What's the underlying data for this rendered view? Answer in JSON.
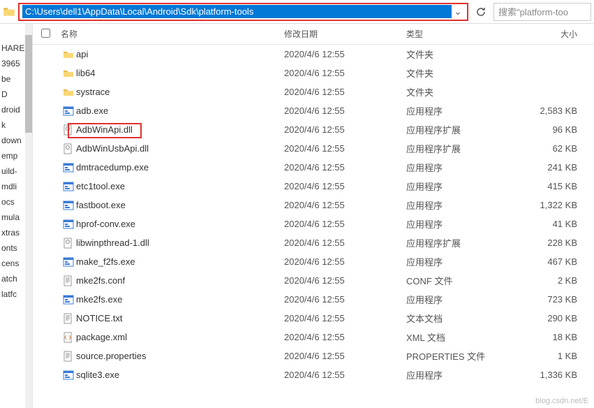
{
  "toolbar": {
    "path": "C:\\Users\\dell1\\AppData\\Local\\Android\\Sdk\\platform-tools",
    "search_placeholder": "搜索\"platform-too"
  },
  "columns": {
    "name": "名称",
    "date": "修改日期",
    "type": "类型",
    "size": "大小"
  },
  "sidebar": {
    "items": [
      "HARE",
      "3965",
      "be",
      "D",
      "droid",
      "k",
      "down",
      "emp",
      "uild-",
      "mdli",
      "ocs",
      "mula",
      "xtras",
      "onts",
      "cens",
      "atch",
      "latfc"
    ]
  },
  "files": [
    {
      "icon": "folder",
      "name": "api",
      "date": "2020/4/6 12:55",
      "type": "文件夹",
      "size": ""
    },
    {
      "icon": "folder",
      "name": "lib64",
      "date": "2020/4/6 12:55",
      "type": "文件夹",
      "size": ""
    },
    {
      "icon": "folder",
      "name": "systrace",
      "date": "2020/4/6 12:55",
      "type": "文件夹",
      "size": ""
    },
    {
      "icon": "exe",
      "name": "adb.exe",
      "date": "2020/4/6 12:55",
      "type": "应用程序",
      "size": "2,583 KB"
    },
    {
      "icon": "dll",
      "name": "AdbWinApi.dll",
      "date": "2020/4/6 12:55",
      "type": "应用程序扩展",
      "size": "96 KB"
    },
    {
      "icon": "dll",
      "name": "AdbWinUsbApi.dll",
      "date": "2020/4/6 12:55",
      "type": "应用程序扩展",
      "size": "62 KB"
    },
    {
      "icon": "exe",
      "name": "dmtracedump.exe",
      "date": "2020/4/6 12:55",
      "type": "应用程序",
      "size": "241 KB"
    },
    {
      "icon": "exe",
      "name": "etc1tool.exe",
      "date": "2020/4/6 12:55",
      "type": "应用程序",
      "size": "415 KB"
    },
    {
      "icon": "exe",
      "name": "fastboot.exe",
      "date": "2020/4/6 12:55",
      "type": "应用程序",
      "size": "1,322 KB"
    },
    {
      "icon": "exe",
      "name": "hprof-conv.exe",
      "date": "2020/4/6 12:55",
      "type": "应用程序",
      "size": "41 KB"
    },
    {
      "icon": "dll",
      "name": "libwinpthread-1.dll",
      "date": "2020/4/6 12:55",
      "type": "应用程序扩展",
      "size": "228 KB"
    },
    {
      "icon": "exe",
      "name": "make_f2fs.exe",
      "date": "2020/4/6 12:55",
      "type": "应用程序",
      "size": "467 KB"
    },
    {
      "icon": "txt",
      "name": "mke2fs.conf",
      "date": "2020/4/6 12:55",
      "type": "CONF 文件",
      "size": "2 KB"
    },
    {
      "icon": "exe",
      "name": "mke2fs.exe",
      "date": "2020/4/6 12:55",
      "type": "应用程序",
      "size": "723 KB"
    },
    {
      "icon": "txt",
      "name": "NOTICE.txt",
      "date": "2020/4/6 12:55",
      "type": "文本文档",
      "size": "290 KB"
    },
    {
      "icon": "xml",
      "name": "package.xml",
      "date": "2020/4/6 12:55",
      "type": "XML 文档",
      "size": "18 KB"
    },
    {
      "icon": "txt",
      "name": "source.properties",
      "date": "2020/4/6 12:55",
      "type": "PROPERTIES 文件",
      "size": "1 KB"
    },
    {
      "icon": "exe",
      "name": "sqlite3.exe",
      "date": "2020/4/6 12:55",
      "type": "应用程序",
      "size": "1,336 KB"
    }
  ],
  "watermark": "blog.csdn.net/E"
}
